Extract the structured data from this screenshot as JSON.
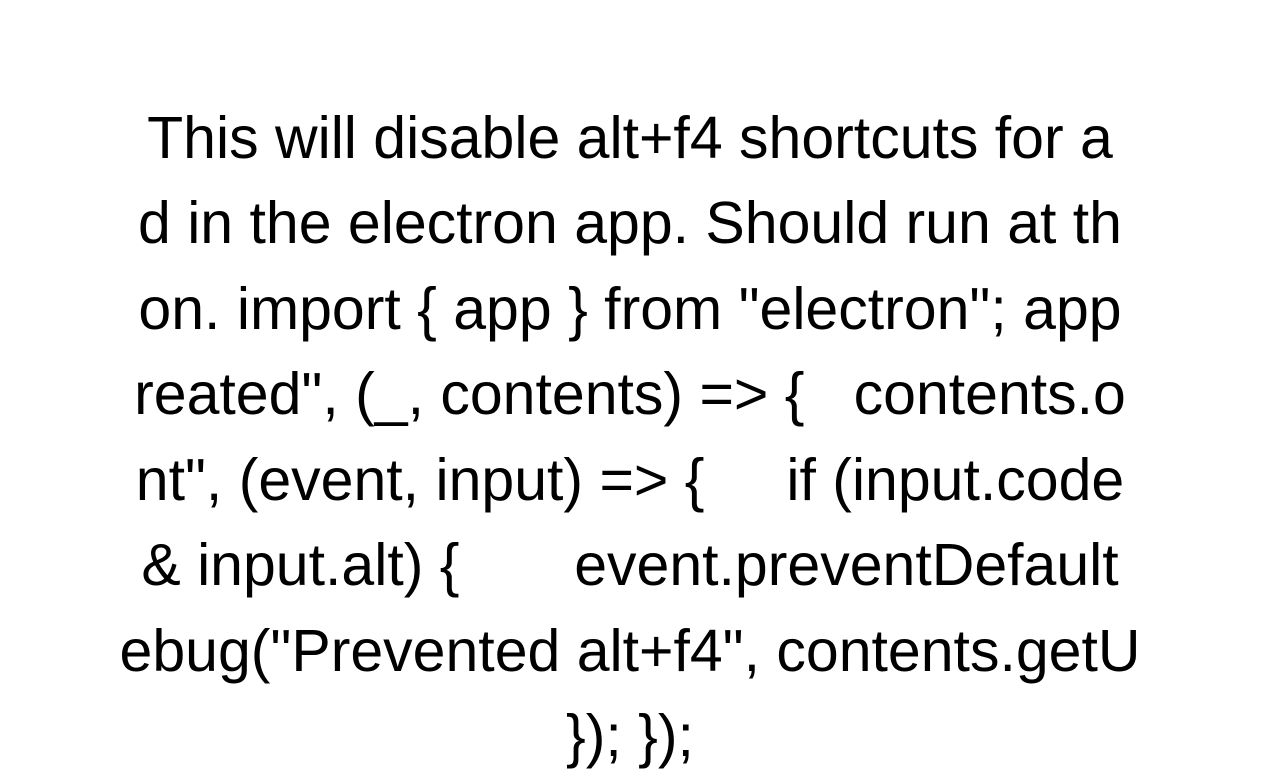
{
  "document": {
    "line1": "This will disable alt+f4 shortcuts for a",
    "line2": "d in the electron app. Should run at th",
    "line3": "on. import { app } from \"electron\"; app",
    "line4": "reated\", (_, contents) => {   contents.o",
    "line5": "nt\", (event, input) => {     if (input.code",
    "line6": "& input.alt) {       event.preventDefault",
    "line7": "ebug(\"Prevented alt+f4\", contents.getU",
    "line8": "}); });"
  }
}
